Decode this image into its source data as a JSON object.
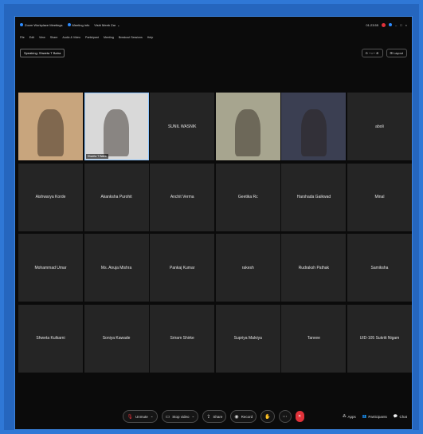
{
  "titlebar": {
    "app": "Zoom Workplace Meetings",
    "info": "Meeting info",
    "host": "Vishi Meeb Zar",
    "time": "01:23:55"
  },
  "menu": [
    "File",
    "Edit",
    "View",
    "Share",
    "Audio & Video",
    "Participant",
    "Meeting",
    "Breakout Sessions",
    "Help"
  ],
  "speaking": "Speaking: Shweta T Batra",
  "view_label": "Layout",
  "participants": [
    {
      "name": "",
      "video": true,
      "color": "#c8a57d"
    },
    {
      "name": "",
      "video": true,
      "color": "#d9d9d9",
      "tag": "Shweta T Batra",
      "highlight": true
    },
    {
      "name": "SUNIL WASNIK",
      "video": false
    },
    {
      "name": "",
      "video": true,
      "color": "#a7a58f"
    },
    {
      "name": "",
      "video": true,
      "color": "#3b3f52"
    },
    {
      "name": "aboli",
      "video": false
    },
    {
      "name": "Aishwarya Korde",
      "video": false
    },
    {
      "name": "Akanksha Purohit",
      "video": false
    },
    {
      "name": "Anchit Verma",
      "video": false
    },
    {
      "name": "Geetika Rc",
      "video": false
    },
    {
      "name": "Harshada Gaikwad",
      "video": false
    },
    {
      "name": "Minal",
      "video": false
    },
    {
      "name": "Mohammad Umar",
      "video": false
    },
    {
      "name": "Ms. Anuja Mishra",
      "video": false
    },
    {
      "name": "Pankaj Kumar",
      "video": false
    },
    {
      "name": "rakesh",
      "video": false
    },
    {
      "name": "Rudraksh Pathak",
      "video": false
    },
    {
      "name": "Samiksha",
      "video": false
    },
    {
      "name": "Shweta Kulkarni",
      "video": false
    },
    {
      "name": "Soniya Kawade",
      "video": false
    },
    {
      "name": "Sriram Shirke",
      "video": false
    },
    {
      "name": "Supriya Malviya",
      "video": false
    },
    {
      "name": "Tanvee",
      "video": false
    },
    {
      "name": "UID-105 Sukriti Nigam",
      "video": false
    }
  ],
  "toolbar": {
    "unmute": "Unmute",
    "stop_video": "Stop video",
    "share": "Share",
    "record": "Record",
    "apps": "Apps",
    "participants": "Participants",
    "chat": "Chat"
  }
}
